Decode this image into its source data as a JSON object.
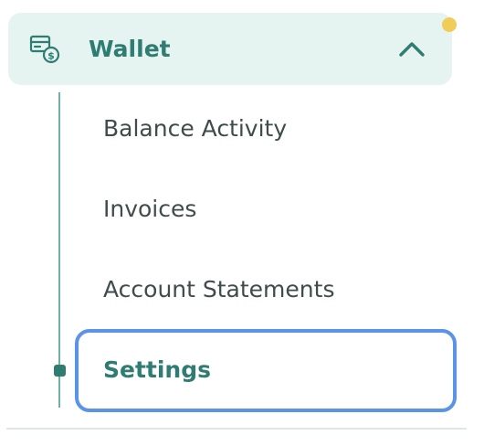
{
  "nav": {
    "group": {
      "label": "Wallet",
      "icon": "wallet-icon",
      "expanded": true,
      "chevron_icon": "chevron-up-icon"
    },
    "items": [
      {
        "label": "Balance Activity",
        "selected": false
      },
      {
        "label": "Invoices",
        "selected": false
      },
      {
        "label": "Account Statements",
        "selected": false
      },
      {
        "label": "Settings",
        "selected": true
      }
    ]
  },
  "colors": {
    "accent": "#2f7c73",
    "header_background": "#e6f4f1",
    "focus_ring": "#5b93e6",
    "notification_dot": "#f0cd58",
    "tree_line": "#6fb0a7",
    "text": "#3f4c4b"
  }
}
